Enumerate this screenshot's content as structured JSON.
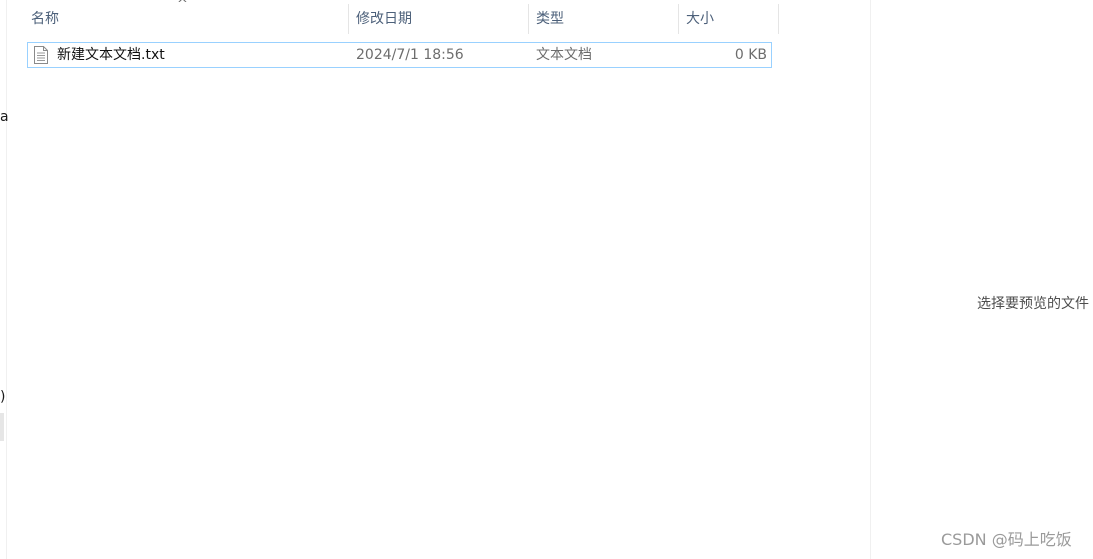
{
  "nav": {
    "fragment_top": "a",
    "fragment_bottom": ")"
  },
  "columns": {
    "name": "名称",
    "date": "修改日期",
    "type": "类型",
    "size": "大小",
    "sort_indicator": "^"
  },
  "files": [
    {
      "icon": "text-file-icon",
      "name": "新建文本文档.txt",
      "date": "2024/7/1 18:56",
      "type": "文本文档",
      "size": "0 KB"
    }
  ],
  "preview": {
    "message": "选择要预览的文件"
  },
  "watermark": "CSDN @码上吃饭",
  "colors": {
    "header_text": "#4c607a",
    "row_border": "#99d1ff",
    "muted_text": "#6d6d6d"
  }
}
